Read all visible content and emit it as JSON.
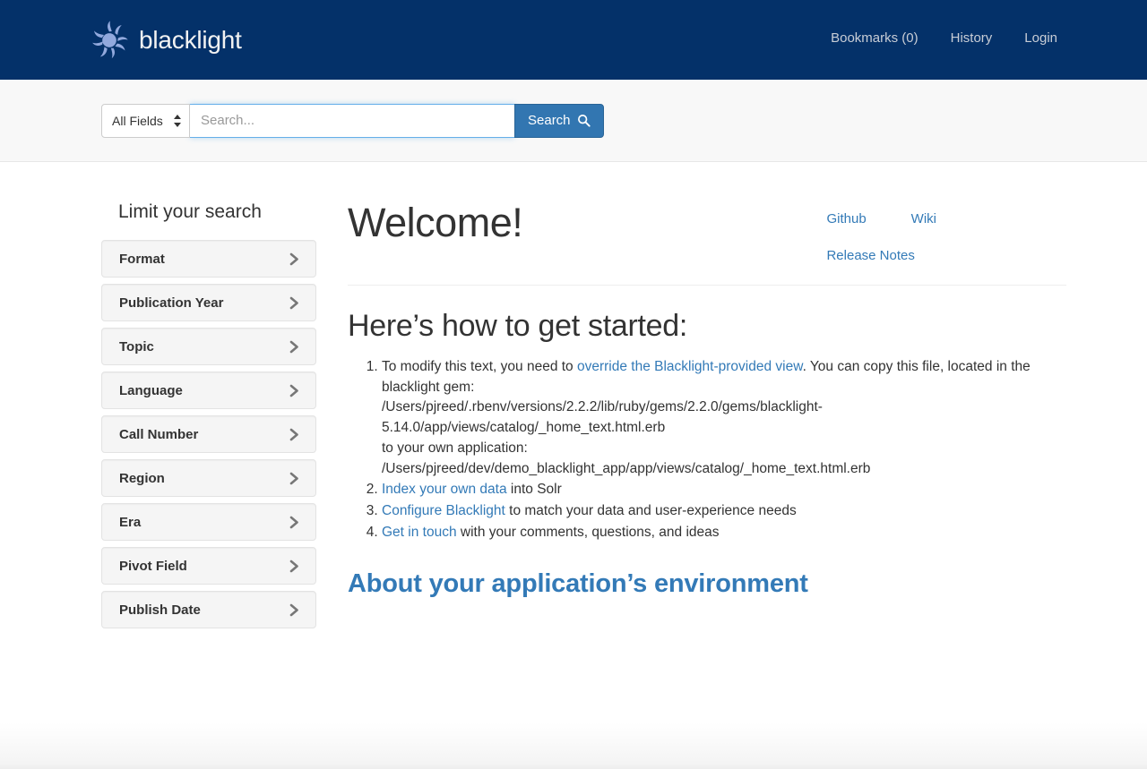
{
  "navbar": {
    "brand_name": "blacklight",
    "brand_logo_icon": "sun-starburst-icon",
    "links": [
      {
        "label": "Bookmarks (0)",
        "name": "bookmarks"
      },
      {
        "label": "History",
        "name": "history"
      },
      {
        "label": "Login",
        "name": "login"
      }
    ]
  },
  "search": {
    "field_selected": "All Fields",
    "placeholder": "Search...",
    "value": "",
    "button_label": "Search",
    "button_icon": "magnifier-icon",
    "caret_icon": "sort-updown-icon"
  },
  "sidebar": {
    "title": "Limit your search",
    "chevron_icon": "chevron-right-icon",
    "facets": [
      {
        "label": "Format"
      },
      {
        "label": "Publication Year"
      },
      {
        "label": "Topic"
      },
      {
        "label": "Language"
      },
      {
        "label": "Call Number"
      },
      {
        "label": "Region"
      },
      {
        "label": "Era"
      },
      {
        "label": "Pivot Field"
      },
      {
        "label": "Publish Date"
      }
    ]
  },
  "main": {
    "welcome_heading": "Welcome!",
    "top_links": [
      {
        "label": "Github"
      },
      {
        "label": "Wiki"
      },
      {
        "label": "Release Notes"
      }
    ],
    "started_heading": "Here’s how to get started:",
    "step1": {
      "text_before": "To modify this text, you need to ",
      "link": "override the Blacklight-provided view",
      "text_after": ". You can copy this file, located in the blacklight gem:",
      "gem_path": "/Users/pjreed/.rbenv/versions/2.2.2/lib/ruby/gems/2.2.0/gems/blacklight-5.14.0/app/views/catalog/_home_text.html.erb",
      "own_app_label": "to your own application:",
      "app_path": "/Users/pjreed/dev/demo_blacklight_app/app/views/catalog/_home_text.html.erb"
    },
    "step2": {
      "link": "Index your own data",
      "text_after": " into Solr"
    },
    "step3": {
      "link": "Configure Blacklight",
      "text_after": " to match your data and user-experience needs"
    },
    "step4": {
      "link": "Get in touch",
      "text_after": " with your comments, questions, and ideas"
    },
    "environment_link": "About your application’s environment"
  },
  "colors": {
    "navbar_bg": "#043169",
    "link_blue": "#337ab7",
    "button_blue": "#3276b1",
    "facet_bg": "#f5f5f5",
    "searchbar_bg": "#f8f8f8",
    "logo_blue": "#8fa8dc"
  }
}
